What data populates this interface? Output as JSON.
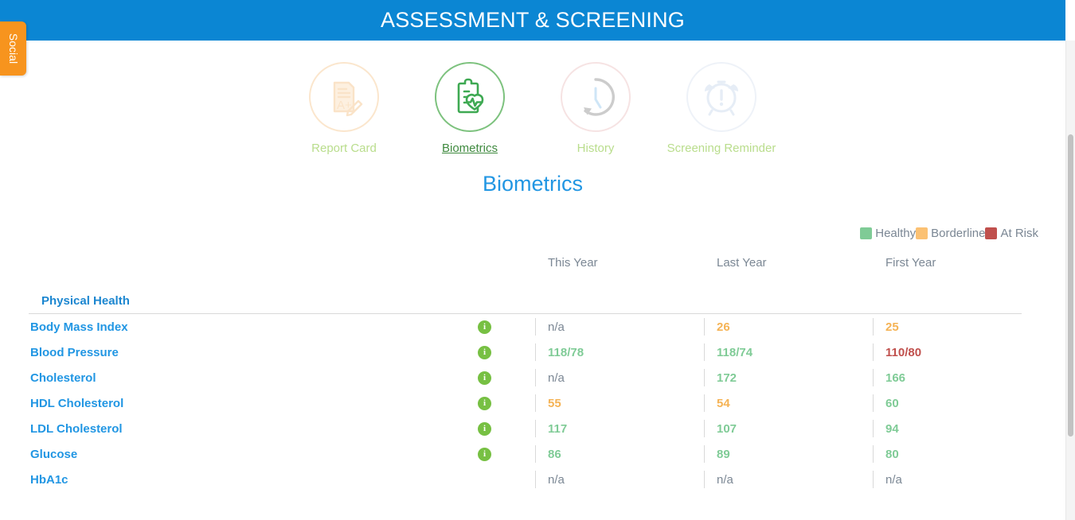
{
  "header": {
    "title": "ASSESSMENT & SCREENING",
    "bar_color": "#0b86d3"
  },
  "social_tab": {
    "label": "Social",
    "color": "#f7941e"
  },
  "nav": {
    "items": [
      {
        "label": "Report Card",
        "icon": "report-card-icon",
        "state": "faded",
        "ring": "ring-orange"
      },
      {
        "label": "Biometrics",
        "icon": "clipboard-heart-icon",
        "state": "active",
        "ring": "ring-green"
      },
      {
        "label": "History",
        "icon": "clock-history-icon",
        "state": "faded",
        "ring": "ring-pink"
      },
      {
        "label": "Screening Reminder",
        "icon": "alarm-clock-icon",
        "state": "faded",
        "ring": "ring-blue"
      }
    ]
  },
  "page_title": "Biometrics",
  "legend": {
    "items": [
      {
        "label": "Healthy",
        "color": "#7fcb96"
      },
      {
        "label": "Borderline",
        "color": "#fbc173"
      },
      {
        "label": "At Risk",
        "color": "#c0504d"
      }
    ]
  },
  "table": {
    "columns": [
      "This Year",
      "Last Year",
      "First Year"
    ],
    "section": "Physical Health",
    "info_icon": "info-icon",
    "rows": [
      {
        "label": "Body Mass Index",
        "has_info": true,
        "values": [
          {
            "text": "n/a",
            "status": "na"
          },
          {
            "text": "26",
            "status": "borderline"
          },
          {
            "text": "25",
            "status": "borderline"
          }
        ]
      },
      {
        "label": "Blood Pressure",
        "has_info": true,
        "values": [
          {
            "text": "118/78",
            "status": "healthy"
          },
          {
            "text": "118/74",
            "status": "healthy"
          },
          {
            "text": "110/80",
            "status": "risk"
          }
        ]
      },
      {
        "label": "Cholesterol",
        "has_info": true,
        "values": [
          {
            "text": "n/a",
            "status": "na"
          },
          {
            "text": "172",
            "status": "healthy"
          },
          {
            "text": "166",
            "status": "healthy"
          }
        ]
      },
      {
        "label": "HDL Cholesterol",
        "has_info": true,
        "values": [
          {
            "text": "55",
            "status": "borderline"
          },
          {
            "text": "54",
            "status": "borderline"
          },
          {
            "text": "60",
            "status": "healthy"
          }
        ]
      },
      {
        "label": "LDL Cholesterol",
        "has_info": true,
        "values": [
          {
            "text": "117",
            "status": "healthy"
          },
          {
            "text": "107",
            "status": "healthy"
          },
          {
            "text": "94",
            "status": "healthy"
          }
        ]
      },
      {
        "label": "Glucose",
        "has_info": true,
        "values": [
          {
            "text": "86",
            "status": "healthy"
          },
          {
            "text": "89",
            "status": "healthy"
          },
          {
            "text": "80",
            "status": "healthy"
          }
        ]
      },
      {
        "label": "HbA1c",
        "has_info": false,
        "values": [
          {
            "text": "n/a",
            "status": "na"
          },
          {
            "text": "n/a",
            "status": "na"
          },
          {
            "text": "n/a",
            "status": "na"
          }
        ]
      }
    ]
  }
}
